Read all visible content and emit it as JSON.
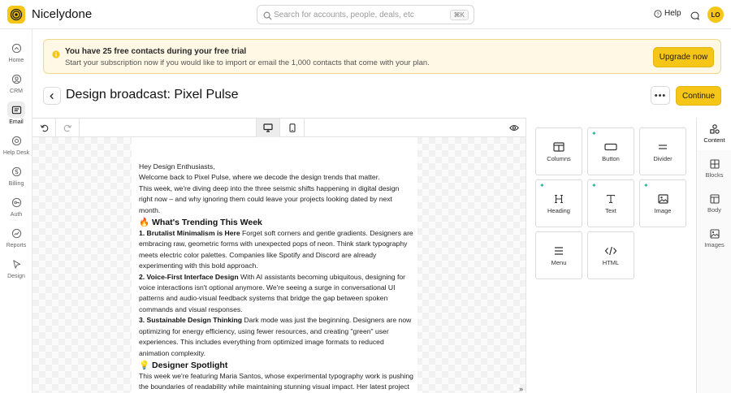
{
  "app": {
    "name": "Nicelydone",
    "logo_icon": "spiral-logo-icon"
  },
  "search": {
    "placeholder": "Search for accounts, people, deals, etc",
    "shortcut": "⌘K"
  },
  "header": {
    "help_label": "Help",
    "avatar_initials": "LO"
  },
  "sidebar": {
    "items": [
      {
        "label": "Home",
        "icon": "home-icon"
      },
      {
        "label": "CRM",
        "icon": "contacts-icon"
      },
      {
        "label": "Email",
        "icon": "email-icon",
        "active": true
      },
      {
        "label": "Help Desk",
        "icon": "help-desk-icon"
      },
      {
        "label": "Billing",
        "icon": "billing-icon"
      },
      {
        "label": "Auth",
        "icon": "auth-icon"
      },
      {
        "label": "Reports",
        "icon": "reports-icon"
      },
      {
        "label": "Design",
        "icon": "design-icon"
      }
    ]
  },
  "banner": {
    "title": "You have 25 free contacts during your free trial",
    "subtitle": "Start your subscription now if you would like to import or email the 1,000 contacts that come with your plan.",
    "button_label": "Upgrade now"
  },
  "page": {
    "title": "Design broadcast: Pixel Pulse",
    "more_label": "•••",
    "continue_label": "Continue"
  },
  "email": {
    "greeting": "Hey Design Enthusiasts,",
    "intro_1": "Welcome back to Pixel Pulse, where we decode the design trends that matter.",
    "intro_2": "This week, we're diving deep into the three seismic shifts happening in digital design right now – and why ignoring them could leave your projects looking dated by next month.",
    "section_1_title": "🔥 What's Trending This Week",
    "item_1_title": "1. Brutalist Minimalism is Here",
    "item_1_body": " Forget soft corners and gentle gradients. Designers are embracing raw, geometric forms with unexpected pops of neon. Think stark typography meets electric color palettes. Companies like Spotify and Discord are already experimenting with this bold approach.",
    "item_2_title": "2. Voice-First Interface Design",
    "item_2_body": " With AI assistants becoming ubiquitous, designing for voice interactions isn't optional anymore. We're seeing a surge in conversational UI patterns and audio-visual feedback systems that bridge the gap between spoken commands and visual responses.",
    "item_3_title": "3. Sustainable Design Thinking",
    "item_3_body": " Dark mode was just the beginning. Designers are now optimizing for energy efficiency, using fewer resources, and creating \"green\" user experiences. This includes everything from optimized image formats to reduced animation complexity.",
    "section_2_title": "💡 Designer Spotlight",
    "spotlight_body": "This week we're featuring Maria Santos, whose experimental typography work is pushing the boundaries of readability while maintaining stunning visual impact. Her latest project transforms data visualizations into kinetic art pieces."
  },
  "content_panel": {
    "tiles": [
      {
        "label": "Columns",
        "icon": "columns-icon",
        "ai": false
      },
      {
        "label": "Button",
        "icon": "button-icon",
        "ai": true
      },
      {
        "label": "Divider",
        "icon": "divider-icon",
        "ai": false
      },
      {
        "label": "Heading",
        "icon": "heading-icon",
        "ai": true
      },
      {
        "label": "Text",
        "icon": "text-icon",
        "ai": true
      },
      {
        "label": "Image",
        "icon": "image-icon",
        "ai": true
      },
      {
        "label": "Menu",
        "icon": "menu-icon",
        "ai": false
      },
      {
        "label": "HTML",
        "icon": "html-code-icon",
        "ai": false
      }
    ]
  },
  "right_tabs": [
    {
      "label": "Content",
      "icon": "shapes-icon",
      "active": true
    },
    {
      "label": "Blocks",
      "icon": "blocks-icon"
    },
    {
      "label": "Body",
      "icon": "body-layout-icon"
    },
    {
      "label": "Images",
      "icon": "images-icon"
    }
  ],
  "colors": {
    "accent": "#f5c518",
    "banner_bg": "#fef8e4",
    "ai_sparkle": "#2fb39a"
  }
}
